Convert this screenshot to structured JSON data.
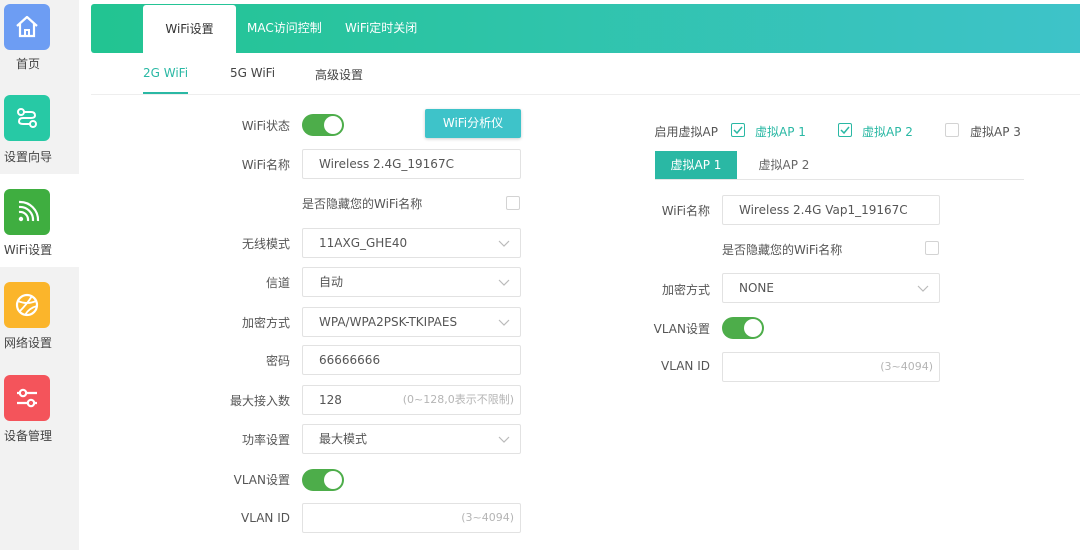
{
  "sidebar": {
    "items": [
      {
        "label": "首页",
        "icon": "home-icon",
        "color": "#6d9df3"
      },
      {
        "label": "设置向导",
        "icon": "route-icon",
        "color": "#27c9a5"
      },
      {
        "label": "WiFi设置",
        "icon": "wifi-icon",
        "color": "#3fae40"
      },
      {
        "label": "网络设置",
        "icon": "globe-icon",
        "color": "#fbb52b"
      },
      {
        "label": "设备管理",
        "icon": "sliders-icon",
        "color": "#f4545b"
      }
    ]
  },
  "topnav": {
    "tabs": [
      "WiFi设置",
      "MAC访问控制",
      "WiFi定时关闭"
    ]
  },
  "subnav": {
    "tabs": [
      "2G WiFi",
      "5G WiFi",
      "高级设置"
    ]
  },
  "left_form": {
    "wifi_status_label": "WiFi状态",
    "wifi_status": "on",
    "analyzer_button": "WiFi分析仪",
    "ssid_label": "WiFi名称",
    "ssid_value": "Wireless 2.4G_19167C",
    "hide_ssid_label": "是否隐藏您的WiFi名称",
    "hide_ssid_checked": false,
    "mode_label": "无线模式",
    "mode_value": "11AXG_GHE40",
    "channel_label": "信道",
    "channel_value": "自动",
    "encryption_label": "加密方式",
    "encryption_value": "WPA/WPA2PSK-TKIPAES",
    "password_label": "密码",
    "password_value": "66666666",
    "max_clients_label": "最大接入数",
    "max_clients_value": "128",
    "max_clients_hint": "(0~128,0表示不限制)",
    "power_label": "功率设置",
    "power_value": "最大模式",
    "vlan_label": "VLAN设置",
    "vlan_enabled": "on",
    "vlan_id_label": "VLAN ID",
    "vlan_id_value": "",
    "vlan_id_hint": "(3~4094)"
  },
  "right_form": {
    "enable_vap_label": "启用虚拟AP",
    "vap_options": [
      {
        "label": "虚拟AP 1",
        "checked": true
      },
      {
        "label": "虚拟AP 2",
        "checked": true
      },
      {
        "label": "虚拟AP 3",
        "checked": false
      }
    ],
    "vap_tabs": [
      "虚拟AP 1",
      "虚拟AP 2"
    ],
    "ssid_label": "WiFi名称",
    "ssid_value": "Wireless 2.4G Vap1_19167C",
    "hide_ssid_label": "是否隐藏您的WiFi名称",
    "hide_ssid_checked": false,
    "encryption_label": "加密方式",
    "encryption_value": "NONE",
    "vlan_label": "VLAN设置",
    "vlan_enabled": "on",
    "vlan_id_label": "VLAN ID",
    "vlan_id_value": "",
    "vlan_id_hint": "(3~4094)"
  },
  "colors": {
    "accent": "#2ab8a4",
    "toggle_on": "#4dad4a",
    "header_gradient_start": "#22c491",
    "header_gradient_end": "#3ec3c9"
  }
}
